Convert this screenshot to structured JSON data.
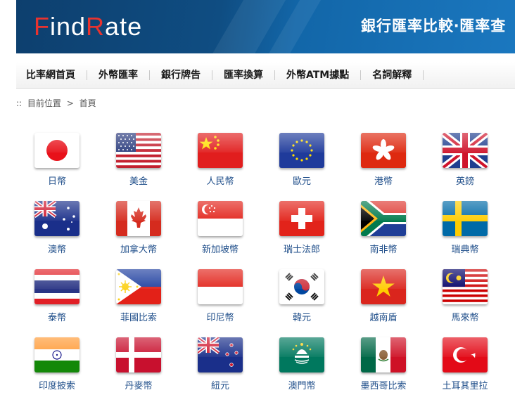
{
  "header": {
    "logo_prefix_accent": "F",
    "logo_part2": "ind",
    "logo_accent2": "R",
    "logo_part3": "ate",
    "slogan": "銀行匯率比較‧匯率查"
  },
  "nav": {
    "items": [
      "比率網首頁",
      "外幣匯率",
      "銀行牌告",
      "匯率換算",
      "外幣ATM據點",
      "名詞解釋"
    ]
  },
  "breadcrumb": {
    "prefix": "::",
    "current_label": "目前位置",
    "separator": ">",
    "home": "首頁"
  },
  "currencies": [
    {
      "label": "日幣",
      "flag": "japan-flag-icon"
    },
    {
      "label": "美金",
      "flag": "usa-flag-icon"
    },
    {
      "label": "人民幣",
      "flag": "china-flag-icon"
    },
    {
      "label": "歐元",
      "flag": "eu-flag-icon"
    },
    {
      "label": "港幣",
      "flag": "hongkong-flag-icon"
    },
    {
      "label": "英鎊",
      "flag": "uk-flag-icon"
    },
    {
      "label": "澳幣",
      "flag": "australia-flag-icon"
    },
    {
      "label": "加拿大幣",
      "flag": "canada-flag-icon"
    },
    {
      "label": "新加坡幣",
      "flag": "singapore-flag-icon"
    },
    {
      "label": "瑞士法郎",
      "flag": "switzerland-flag-icon"
    },
    {
      "label": "南非幣",
      "flag": "southafrica-flag-icon"
    },
    {
      "label": "瑞典幣",
      "flag": "sweden-flag-icon"
    },
    {
      "label": "泰幣",
      "flag": "thailand-flag-icon"
    },
    {
      "label": "菲國比索",
      "flag": "philippines-flag-icon"
    },
    {
      "label": "印尼幣",
      "flag": "indonesia-flag-icon"
    },
    {
      "label": "韓元",
      "flag": "korea-flag-icon"
    },
    {
      "label": "越南盾",
      "flag": "vietnam-flag-icon"
    },
    {
      "label": "馬來幣",
      "flag": "malaysia-flag-icon"
    },
    {
      "label": "印度披索",
      "flag": "india-flag-icon"
    },
    {
      "label": "丹麥幣",
      "flag": "denmark-flag-icon"
    },
    {
      "label": "紐元",
      "flag": "newzealand-flag-icon"
    },
    {
      "label": "澳門幣",
      "flag": "macau-flag-icon"
    },
    {
      "label": "墨西哥比索",
      "flag": "mexico-flag-icon"
    },
    {
      "label": "土耳其里拉",
      "flag": "turkey-flag-icon"
    }
  ],
  "colors": {
    "banner": "#0f4d82",
    "logo_accent": "#e8332f",
    "link": "#1f4e8a"
  }
}
